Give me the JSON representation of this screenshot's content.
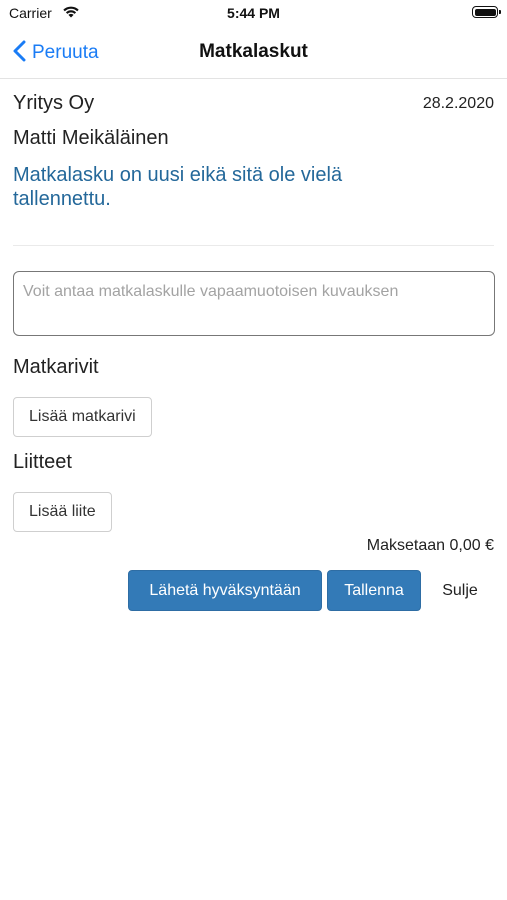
{
  "status_bar": {
    "carrier": "Carrier",
    "time": "5:44 PM",
    "icons": [
      "wifi-icon",
      "battery-icon"
    ]
  },
  "nav": {
    "back_label": "Peruuta",
    "title": "Matkalaskut",
    "accent_color": "#1a7cf5"
  },
  "header": {
    "company": "Yritys Oy",
    "date": "28.2.2020",
    "person": "Matti Meikäläinen",
    "notice": "Matkalasku on uusi eikä sitä ole vielä tallennettu.",
    "notice_color": "#24689a"
  },
  "description": {
    "value": "",
    "placeholder": "Voit antaa matkalaskulle vapaamuotoisen kuvauksen"
  },
  "trip_rows": {
    "heading": "Matkarivit",
    "add_button": "Lisää matkarivi"
  },
  "attachments": {
    "heading": "Liitteet",
    "add_button": "Lisää liite"
  },
  "footer": {
    "total": "Maksetaan 0,00 €",
    "submit_button": "Lähetä hyväksyntään",
    "save_button": "Tallenna",
    "close_button": "Sulje",
    "primary_color": "#337ab7"
  }
}
